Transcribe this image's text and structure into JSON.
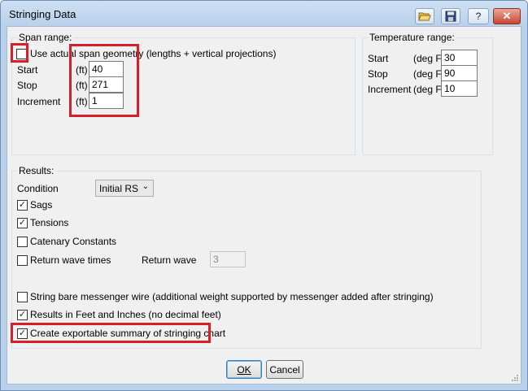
{
  "window": {
    "title": "Stringing Data",
    "toolbar": {
      "open_icon": "folder-open-icon",
      "save_icon": "floppy-disk-icon",
      "help_label": "?",
      "close_label": "✕"
    }
  },
  "span_range": {
    "title": "Span range:",
    "use_actual_label": "Use actual span geometry (lengths + vertical projections)",
    "use_actual_checked": false,
    "start": {
      "label": "Start",
      "unit": "(ft)",
      "value": "40"
    },
    "stop": {
      "label": "Stop",
      "unit": "(ft)",
      "value": "271"
    },
    "increment": {
      "label": "Increment",
      "unit": "(ft)",
      "value": "1"
    }
  },
  "temperature_range": {
    "title": "Temperature range:",
    "start": {
      "label": "Start",
      "unit": "(deg F)",
      "value": "30"
    },
    "stop": {
      "label": "Stop",
      "unit": "(deg F)",
      "value": "90"
    },
    "increment": {
      "label": "Increment",
      "unit": "(deg F)",
      "value": "10"
    }
  },
  "results": {
    "title": "Results:",
    "condition_label": "Condition",
    "condition_value": "Initial RS",
    "sags": {
      "label": "Sags",
      "checked": true
    },
    "tensions": {
      "label": "Tensions",
      "checked": true
    },
    "catenary": {
      "label": "Catenary Constants",
      "checked": false
    },
    "return_wave": {
      "label": "Return wave times",
      "checked": false
    },
    "return_wave_field_label": "Return wave",
    "return_wave_value": "3",
    "bare_messenger": {
      "label": "String bare messenger wire (additional weight supported by messenger added after stringing)",
      "checked": false
    },
    "feet_inches": {
      "label": "Results in Feet and Inches (no decimal feet)",
      "checked": true
    },
    "exportable": {
      "label": "Create exportable summary of stringing chart",
      "checked": true
    }
  },
  "buttons": {
    "ok": "OK",
    "cancel": "Cancel"
  },
  "colors": {
    "highlight": "#d61f2b",
    "dialog_bg": "#f0f0f0",
    "title_bg": "#b9d1ea"
  }
}
